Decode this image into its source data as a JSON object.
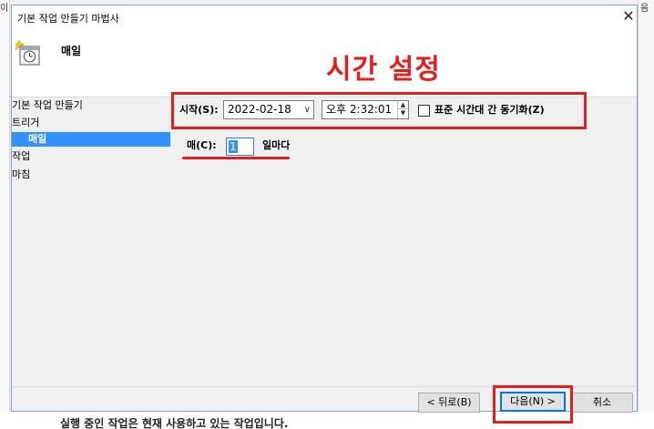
{
  "background": {
    "bottom_text": "실행 중인 작업은 현재 사용하고 있는 작업입니다.",
    "corner_left": "이",
    "corner_right": "음"
  },
  "dialog": {
    "title": "기본 작업 만들기 마법사",
    "close_glyph": "✕",
    "header_title": "매일",
    "header_icon": "calendar-clock-icon"
  },
  "annotation": {
    "text": "시간 설정",
    "color": "#e21f1f"
  },
  "nav": {
    "items": [
      {
        "label": "기본 작업 만들기"
      },
      {
        "label": "트리거"
      },
      {
        "label": "매일",
        "selected": true
      },
      {
        "label": "작업"
      },
      {
        "label": "마침"
      }
    ],
    "selected_color": "#3390ff"
  },
  "trigger": {
    "start_label": "시작(S):",
    "date_value": "2022-02-18",
    "date_dropdown_glyph": "∨",
    "time_value": "오후  2:32:01",
    "sync_label": "표준 시간대 간 동기화(Z)",
    "sync_checked": false,
    "recur_label": "매(C):",
    "recur_value": "1",
    "recur_suffix": "일마다"
  },
  "footer": {
    "back_label": "< 뒤로(B)",
    "next_label": "다음(N) >",
    "cancel_label": "취소"
  }
}
